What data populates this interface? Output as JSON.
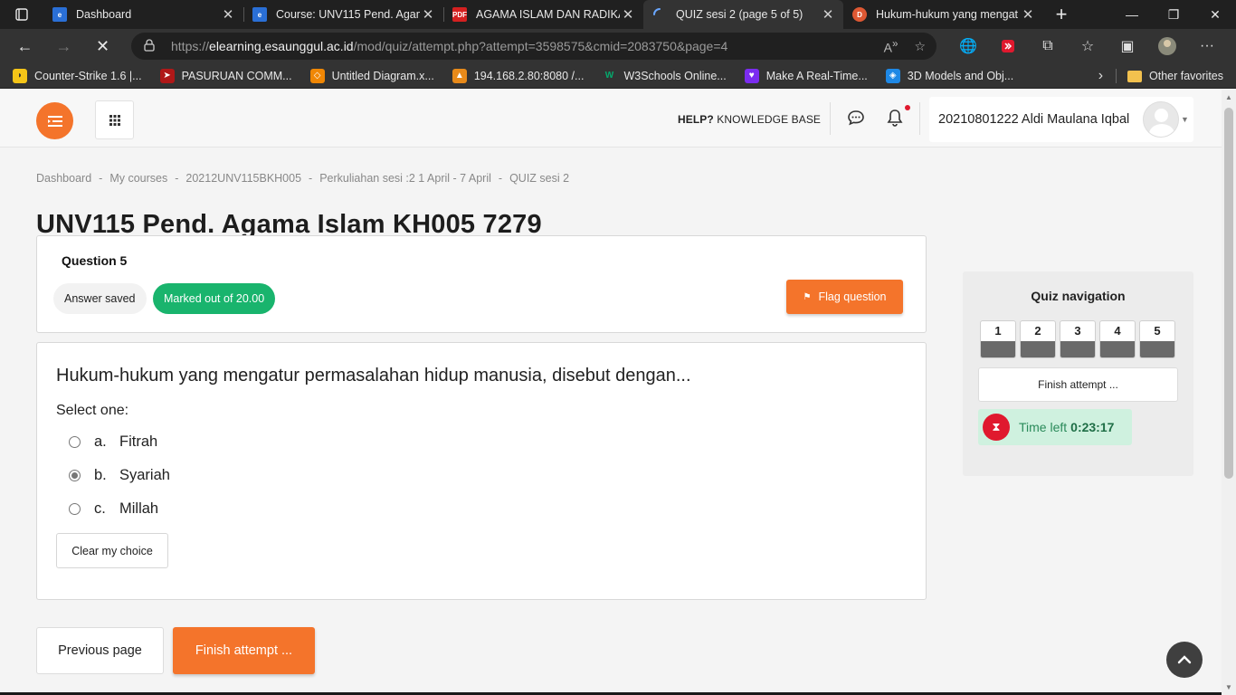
{
  "browser": {
    "tabs": [
      {
        "title": "Dashboard",
        "favicon": "site-icon",
        "active": false
      },
      {
        "title": "Course: UNV115 Pend. Agam",
        "favicon": "site-icon",
        "active": false
      },
      {
        "title": "AGAMA ISLAM DAN RADIKAL",
        "favicon": "pdf-icon",
        "active": false
      },
      {
        "title": "QUIZ sesi 2 (page 5 of 5)",
        "favicon": "loading-icon",
        "active": true
      },
      {
        "title": "Hukum-hukum yang mengat",
        "favicon": "duckduckgo-icon",
        "active": false
      }
    ],
    "url_prefix": "https://",
    "url_domain": "elearning.esaunggul.ac.id",
    "url_path": "/mod/quiz/attempt.php?attempt=3598575&cmid=2083750&page=4",
    "favorites": [
      {
        "label": "Counter-Strike 1.6 |...",
        "icon": "banana-icon"
      },
      {
        "label": "PASURUAN COMM...",
        "icon": "bird-icon"
      },
      {
        "label": "Untitled Diagram.x...",
        "icon": "drawio-icon"
      },
      {
        "label": "194.168.2.80:8080 /...",
        "icon": "server-icon"
      },
      {
        "label": "W3Schools Online...",
        "icon": "w3schools-icon"
      },
      {
        "label": "Make A Real-Time...",
        "icon": "heart-icon"
      },
      {
        "label": "3D Models and Obj...",
        "icon": "cube-icon"
      }
    ],
    "other_favorites": "Other favorites"
  },
  "topnav": {
    "help_bold": "HELP?",
    "help_rest": " KNOWLEDGE BASE",
    "user_name": "20210801222 Aldi Maulana Iqbal"
  },
  "breadcrumb": [
    "Dashboard",
    "My courses",
    "20212UNV115BKH005",
    "Perkuliahan sesi :2 1 April - 7 April",
    "QUIZ sesi 2"
  ],
  "course_title": "UNV115 Pend. Agama Islam KH005 7279",
  "question_info": {
    "number": "Question 5",
    "state": "Answer saved",
    "mark": "Marked out of 20.00",
    "flag_label": "Flag question"
  },
  "question": {
    "text": "Hukum-hukum yang mengatur permasalahan hidup manusia, disebut dengan...",
    "prompt": "Select one:",
    "options": [
      {
        "letter": "a.",
        "label": "Fitrah",
        "selected": false
      },
      {
        "letter": "b.",
        "label": "Syariah",
        "selected": true
      },
      {
        "letter": "c.",
        "label": "Millah",
        "selected": false
      }
    ],
    "clear_label": "Clear my choice"
  },
  "nav_buttons": {
    "previous": "Previous page",
    "finish": "Finish attempt ..."
  },
  "quiz_nav": {
    "title": "Quiz navigation",
    "questions": [
      "1",
      "2",
      "3",
      "4",
      "5"
    ],
    "finish": "Finish attempt ...",
    "time_label": "Time left",
    "time_value": "0:23:17"
  },
  "colors": {
    "accent": "#f4742b",
    "success": "#19b46d",
    "danger": "#e0192e"
  }
}
